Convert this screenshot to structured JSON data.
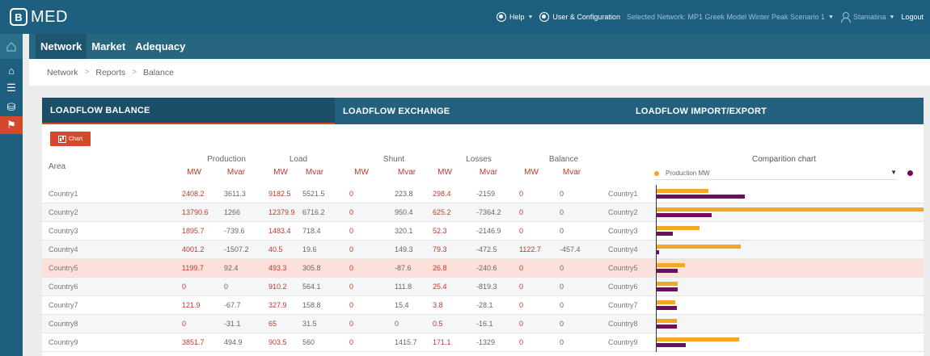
{
  "app": {
    "logo_mark": "B",
    "logo_text": "MED"
  },
  "topbar": {
    "help": "Help",
    "user_config": "User & Configuration",
    "selected_network": "Selected Network: MP1 Greek Model Winter Peak Scenario 1",
    "username": "Stamatina",
    "logout": "Logout"
  },
  "nav": {
    "tabs": [
      "Network",
      "Market",
      "Adequacy"
    ]
  },
  "breadcrumb": [
    "Network",
    "Reports",
    "Balance"
  ],
  "report_tabs": [
    "LOADFLOW BALANCE",
    "LOADFLOW EXCHANGE",
    "LOADFLOW IMPORT/EXPORT"
  ],
  "chart_button": "Chart",
  "table": {
    "area_header": "Area",
    "groups": [
      "Production",
      "Load",
      "Shunt",
      "Losses",
      "Balance"
    ],
    "units": [
      "MW",
      "Mvar",
      "MW",
      "Mvar",
      "MW",
      "Mvar",
      "MW",
      "Mvar",
      "MW",
      "Mvar"
    ],
    "rows": [
      {
        "area": "Country1",
        "values": [
          "2408.2",
          "3611.3",
          "9182.5",
          "5521.5",
          "0",
          "223.8",
          "298.4",
          "-2159",
          "0",
          "0"
        ]
      },
      {
        "area": "Country2",
        "values": [
          "13790.6",
          "1266",
          "12379.9",
          "6716.2",
          "0",
          "950.4",
          "625.2",
          "-7364.2",
          "0",
          "0"
        ]
      },
      {
        "area": "Country3",
        "values": [
          "1895.7",
          "-739.6",
          "1483.4",
          "718.4",
          "0",
          "320.1",
          "52.3",
          "-2146.9",
          "0",
          "0"
        ]
      },
      {
        "area": "Country4",
        "values": [
          "4001.2",
          "-1507.2",
          "40.5",
          "19.6",
          "0",
          "149.3",
          "79.3",
          "-472.5",
          "1122.7",
          "-457.4"
        ]
      },
      {
        "area": "Country5",
        "values": [
          "1199.7",
          "92.4",
          "493.3",
          "305.8",
          "0",
          "-87.6",
          "26.8",
          "-240.6",
          "0",
          "0"
        ]
      },
      {
        "area": "Country6",
        "values": [
          "0",
          "0",
          "910.2",
          "564.1",
          "0",
          "111.8",
          "25.4",
          "-819.3",
          "0",
          "0"
        ]
      },
      {
        "area": "Country7",
        "values": [
          "121.9",
          "-67.7",
          "327.9",
          "158.8",
          "0",
          "15.4",
          "3.8",
          "-28.1",
          "0",
          "0"
        ]
      },
      {
        "area": "Country8",
        "values": [
          "0",
          "-31.1",
          "65",
          "31.5",
          "0",
          "0",
          "0.5",
          "-16.1",
          "0",
          "0"
        ]
      },
      {
        "area": "Country9",
        "values": [
          "3851.7",
          "494.9",
          "903.5",
          "560",
          "0",
          "1415.7",
          "171.1",
          "-1329",
          "0",
          "0"
        ]
      }
    ]
  },
  "comparison": {
    "title": "Comparition chart",
    "selected_metric": "Production MW",
    "colors": {
      "orange": "#f5a623",
      "purple": "#6e0f5e"
    },
    "bars": [
      {
        "country": "Country1",
        "orange": 0.195,
        "purple": 0.33
      },
      {
        "country": "Country2",
        "orange": 1.0,
        "purple": 0.205
      },
      {
        "country": "Country3",
        "orange": 0.16,
        "purple": 0.06
      },
      {
        "country": "Country4",
        "orange": 0.315,
        "purple": 0.008
      },
      {
        "country": "Country5",
        "orange": 0.105,
        "purple": 0.08
      },
      {
        "country": "Country6",
        "orange": 0.08,
        "purple": 0.08
      },
      {
        "country": "Country7",
        "orange": 0.07,
        "purple": 0.075
      },
      {
        "country": "Country8",
        "orange": 0.075,
        "purple": 0.075
      },
      {
        "country": "Country9",
        "orange": 0.31,
        "purple": 0.11
      }
    ]
  }
}
